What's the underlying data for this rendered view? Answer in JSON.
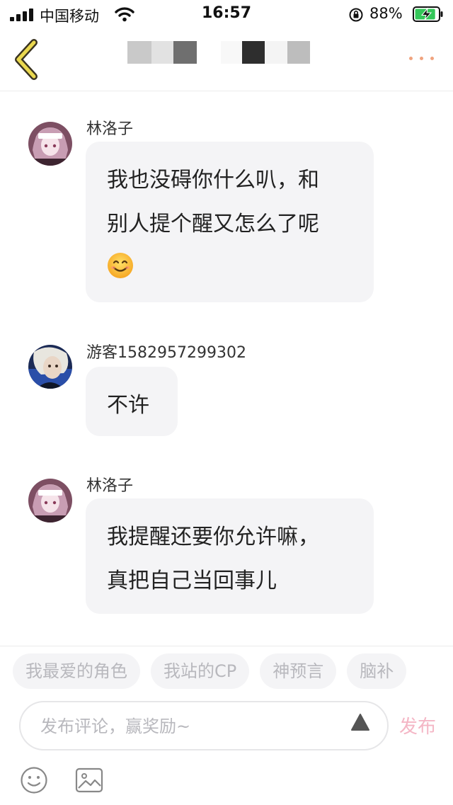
{
  "status_bar": {
    "carrier": "中国移动",
    "time": "16:57",
    "battery_percent": "88%",
    "battery_level": 0.88
  },
  "nav": {
    "back_icon": "chevron-left-icon",
    "more_icon": "ellipsis-icon",
    "accent_color": "#f0a37e"
  },
  "messages": [
    {
      "username": "林洛子",
      "lines": [
        "我也没碍你什么叭，和",
        "别人提个醒又怎么了呢"
      ],
      "emoji": "smiling-face-emoji"
    },
    {
      "username": "游客1582957299302",
      "lines": [
        "不许"
      ]
    },
    {
      "username": "林洛子",
      "lines": [
        "我提醒还要你允许嘛，",
        "真把自己当回事儿"
      ]
    }
  ],
  "bottom_bar": {
    "chips": [
      "我最爱的角色",
      "我站的CP",
      "神预言",
      "脑补"
    ],
    "comment_placeholder": "发布评论，赢奖励~",
    "comment_value": "",
    "publish_label": "发布",
    "publish_color": "#f4b6c5"
  }
}
